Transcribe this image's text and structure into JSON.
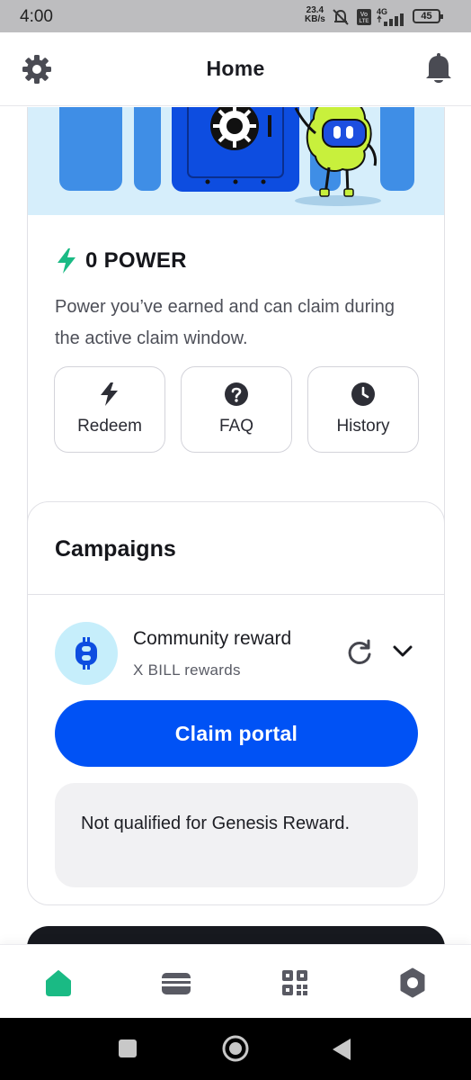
{
  "status_bar": {
    "time": "4:00",
    "net_speed_value": "23.4",
    "net_speed_unit": "KB/s",
    "network_type": "4G",
    "volte_label": "Vo LTE",
    "battery_level": "45"
  },
  "header": {
    "title": "Home",
    "icons": [
      "gear-icon",
      "bell-icon"
    ]
  },
  "power": {
    "value_label": "0 POWER",
    "description": "Power you’ve earned and can claim during the active claim window.",
    "actions": [
      {
        "label": "Redeem",
        "icon": "bolt-icon"
      },
      {
        "label": "FAQ",
        "icon": "question-icon"
      },
      {
        "label": "History",
        "icon": "clock-icon"
      }
    ]
  },
  "campaigns": {
    "title": "Campaigns",
    "item": {
      "name": "Community reward",
      "subtitle": "X BILL rewards",
      "icon": "bill-coin-icon"
    },
    "claim_button": "Claim portal",
    "notice": "Not qualified for Genesis Reward."
  },
  "bottom_nav": [
    {
      "name": "home",
      "icon": "home-icon",
      "active": true
    },
    {
      "name": "wallet",
      "icon": "wallet-icon",
      "active": false
    },
    {
      "name": "scan",
      "icon": "qr-icon",
      "active": false
    },
    {
      "name": "settings",
      "icon": "settings-icon",
      "active": false
    }
  ],
  "colors": {
    "accent": "#0052f5",
    "success_green": "#1aba84",
    "banner_bg": "#d6eefb",
    "coin_bg": "#c6eefb",
    "mascot_green": "#c8f03c"
  }
}
